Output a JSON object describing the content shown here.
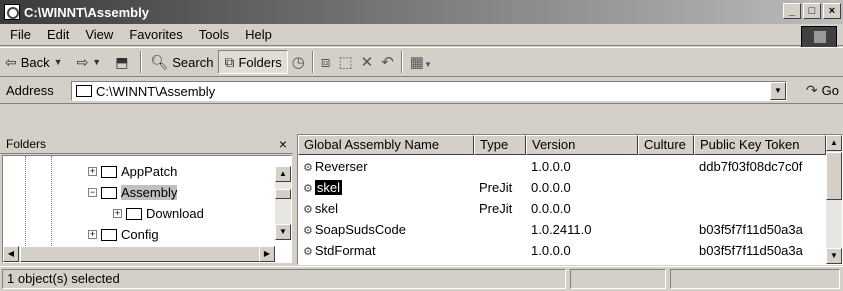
{
  "window": {
    "title": "C:\\WINNT\\Assembly"
  },
  "menu": [
    "File",
    "Edit",
    "View",
    "Favorites",
    "Tools",
    "Help"
  ],
  "toolbar": {
    "back": "Back",
    "search": "Search",
    "folders": "Folders"
  },
  "address": {
    "label": "Address",
    "value": "C:\\WINNT\\Assembly",
    "go": "Go"
  },
  "folders_pane": {
    "title": "Folders",
    "close": "×",
    "items": [
      {
        "label": "AppPatch",
        "expander": "+"
      },
      {
        "label": "Assembly",
        "expander": "−"
      },
      {
        "label": "Download",
        "expander": "+"
      },
      {
        "label": "Config",
        "expander": "+"
      }
    ]
  },
  "list": {
    "columns": [
      "Global Assembly Name",
      "Type",
      "Version",
      "Culture",
      "Public Key Token"
    ],
    "rows": [
      {
        "name": "Reverser",
        "type": "",
        "version": "1.0.0.0",
        "culture": "",
        "token": "ddb7f03f08dc7c0f"
      },
      {
        "name": "skel",
        "type": "PreJit",
        "version": "0.0.0.0",
        "culture": "",
        "token": ""
      },
      {
        "name": "skel",
        "type": "PreJit",
        "version": "0.0.0.0",
        "culture": "",
        "token": ""
      },
      {
        "name": "SoapSudsCode",
        "type": "",
        "version": "1.0.2411.0",
        "culture": "",
        "token": "b03f5f7f11d50a3a"
      },
      {
        "name": "StdFormat",
        "type": "",
        "version": "1.0.0.0",
        "culture": "",
        "token": "b03f5f7f11d50a3a"
      }
    ]
  },
  "status": {
    "text": "1 object(s) selected"
  }
}
